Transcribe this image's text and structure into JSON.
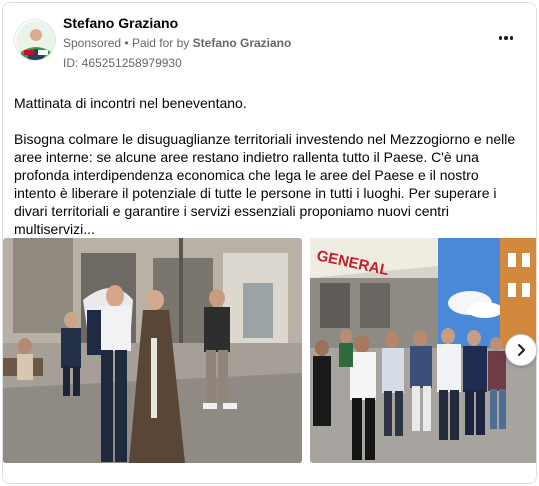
{
  "post": {
    "author": "Stefano Graziano",
    "sponsored_label": "Sponsored",
    "separator": "•",
    "paid_for_prefix": "Paid for by",
    "paid_for_by": "Stefano Graziano",
    "ad_id": "ID: 465251258979930",
    "paragraph1": "Mattinata di incontri nel beneventano.",
    "paragraph2": "Bisogna colmare le disuguaglianze territoriali investendo nel Mezzogiorno e nelle aree interne: se alcune aree restano indietro rallenta tutto il Paese. C'è una profonda interdipendenza economica che lega le aree del Paese e il nostro intento è liberare il potenziale di tutte le persone in tutti i luoghi. Per superare i divari territoriali e garantire i servizi essenziali proponiamo nuovi centri multiservizi..."
  },
  "photos": [
    {
      "name": "photo-street-meeting"
    },
    {
      "name": "photo-group-in-front-of-store",
      "sign_text": "GENERAL"
    }
  ],
  "icons": {
    "more": "more-options-icon",
    "next": "chevron-right-icon"
  },
  "colors": {
    "text": "#050505",
    "secondary": "#65676b",
    "border": "#dddfe2"
  }
}
